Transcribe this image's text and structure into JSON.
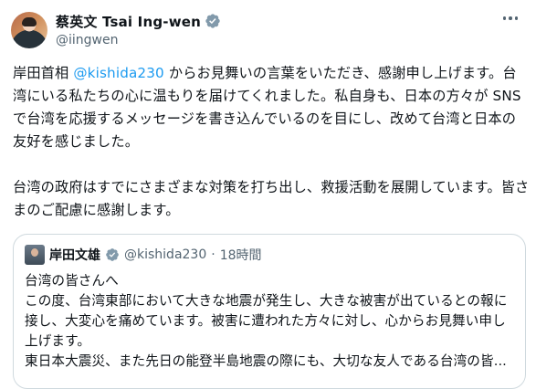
{
  "tweet": {
    "display_name": "蔡英文 Tsai Ing-wen",
    "handle": "@iingwen",
    "verified": true,
    "body": {
      "part1": "岸田首相 ",
      "mention": "@kishida230",
      "part2": " からお見舞いの言葉をいただき、感謝申し上げます。台湾にいる私たちの心に温もりを届けてくれました。私自身も、日本の方々が SNS で台湾を応援するメッセージを書き込んでいるのを目にし、改めて台湾と日本の友好を感じました。\n\n台湾の政府はすでにさまざまな対策を打ち出し、救援活動を展開しています。皆さまのご配慮に感謝します。"
    }
  },
  "quote": {
    "display_name": "岸田文雄",
    "handle": "@kishida230",
    "separator": "·",
    "time": "18時間",
    "lines": [
      "台湾の皆さんへ",
      "この度、台湾東部において大きな地震が発生し、大きな被害が出ているとの報に",
      "接し、大変心を痛めています。被害に遭われた方々に対し、心からお見舞い申し",
      "上げます。",
      "東日本大震災、また先日の能登半島地震の際にも、大切な友人である台湾の皆..."
    ]
  },
  "icons": {
    "verified": "verified-badge-icon",
    "more": "more-icon"
  },
  "colors": {
    "accent": "#1d9bf0",
    "secondary_text": "#536471",
    "border": "#cfd9de"
  }
}
